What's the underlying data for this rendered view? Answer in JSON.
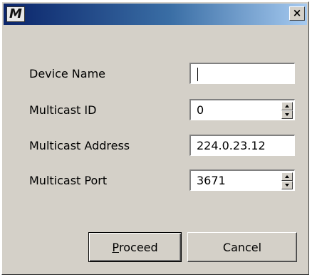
{
  "window": {
    "icon_letter": "M",
    "close_glyph": "×"
  },
  "form": {
    "device_name": {
      "label": "Device Name",
      "value": ""
    },
    "multicast_id": {
      "label": "Multicast ID",
      "value": "0"
    },
    "multicast_address": {
      "label": "Multicast Address",
      "value": "224.0.23.12"
    },
    "multicast_port": {
      "label": "Multicast Port",
      "value": "3671"
    }
  },
  "buttons": {
    "proceed_mnemonic": "P",
    "proceed_rest": "roceed",
    "cancel": "Cancel"
  }
}
